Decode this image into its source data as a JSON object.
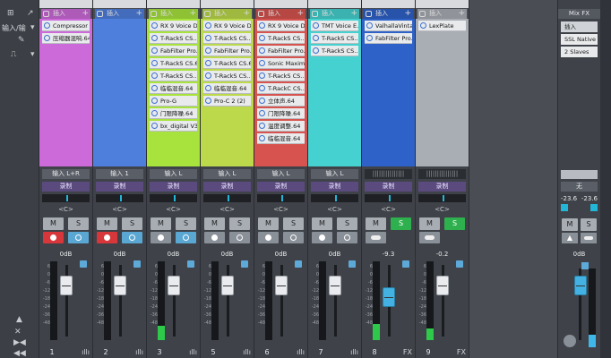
{
  "left_panel": {
    "input_label": "输入/输",
    "rows": [
      "▸",
      "⇄",
      "↺",
      "▸"
    ]
  },
  "channels": [
    {
      "id": "1",
      "head": "插入",
      "color": "#cc6ad9",
      "slots": [
        "Compressor",
        "压缩器混响.64"
      ],
      "io": "输入 L+R",
      "rec": "录制",
      "pan": "<C>",
      "solo_on": false,
      "btn_a": "red",
      "btn_b": "blue",
      "vol": "0dB",
      "meter": 0,
      "cap_blue": false
    },
    {
      "id": "2",
      "head": "插入",
      "color": "#4f7fdd",
      "slots": [],
      "io": "输入 1",
      "rec": "录制",
      "pan": "<C>",
      "solo_on": false,
      "btn_a": "red",
      "btn_b": "blue",
      "vol": "0dB",
      "meter": 0,
      "cap_blue": false
    },
    {
      "id": "3",
      "head": "插入",
      "color": "#a8e33d",
      "slots": [
        "RX 9 Voice D...",
        "T-RackS CS...",
        "FabFilter Pro...",
        "T-RackS CS.64",
        "T-RackS CS...",
        "临临混音.64",
        "Pro-G",
        "门限降噪.64",
        "bx_digital V3..."
      ],
      "io": "输入 L",
      "rec": "录制",
      "pan": "<C>",
      "solo_on": false,
      "btn_a": "gray",
      "btn_b": "blue",
      "vol": "0dB",
      "meter": 0.18,
      "cap_blue": false
    },
    {
      "id": "4",
      "head": "插入",
      "color": "#bbd94a",
      "slots": [
        "RX 9 Voice D...",
        "T-RackS CS...",
        "FabFilter Pro...",
        "T-RackS CS.64",
        "T-RackS CS...",
        "临临混音.64",
        "Pro-C 2 (2)"
      ],
      "io": "输入 L",
      "rec": "录制",
      "pan": "<C>",
      "solo_on": false,
      "btn_a": "gray",
      "btn_b": "gray",
      "vol": "0dB",
      "meter": 0,
      "cap_blue": false
    },
    {
      "id": "5",
      "head": "插入",
      "color": "#d6534f",
      "slots": [
        "RX 9 Voice D...",
        "T-RackS CS...",
        "FabFilter Pro...",
        "Sonic Maxim...",
        "T-RackS CS...",
        "T-RackC CS...",
        "立体声.64",
        "门限降噪.64",
        "温度调整.64",
        "临临混音.64"
      ],
      "io": "输入 L",
      "rec": "录制",
      "pan": "<C>",
      "solo_on": false,
      "btn_a": "gray",
      "btn_b": "gray",
      "vol": "0dB",
      "meter": 0,
      "cap_blue": false
    },
    {
      "id": "6",
      "head": "插入",
      "color": "#45d1cf",
      "slots": [
        "TMT Voice E...",
        "T-RackS CS...",
        "T-RackS CS..."
      ],
      "io": "输入 L",
      "rec": "录制",
      "pan": "<C>",
      "solo_on": false,
      "btn_a": "gray",
      "btn_b": "gray",
      "vol": "0dB",
      "meter": 0,
      "cap_blue": false
    },
    {
      "id": "7",
      "head": "插入",
      "color": "#2f62c8",
      "slots": [
        "ValhallaVinta...",
        "FabFilter Pro..."
      ],
      "io": "|||||||||||||||",
      "rec": "录制",
      "pan": "<C>",
      "solo_on": true,
      "btn_a": "gray",
      "btn_b": "none",
      "vol": "-9.3",
      "meter": 0.2,
      "cap_blue": true
    },
    {
      "id": "8",
      "head": "插入",
      "color": "#a9adb4",
      "slots": [
        "LexPlate"
      ],
      "io": "|||||||||||||||",
      "rec": "录制",
      "pan": "<C>",
      "solo_on": true,
      "btn_a": "gray",
      "btn_b": "none",
      "vol": "-0.2",
      "meter": 0.15,
      "cap_blue": false
    }
  ],
  "channel_numbers": [
    "1",
    "2",
    "3",
    "5",
    "6",
    "7",
    "8",
    "9"
  ],
  "fx_label": "FX",
  "mix_fx": {
    "title": "Mix FX",
    "slots": [
      "插入",
      "SSL Native B...",
      "2 Slaves"
    ],
    "preset": "无",
    "left_val": "-23.6",
    "right_val": "-23.6",
    "ms_m": "M",
    "ms_s": "S",
    "vol": "0dB"
  },
  "ms_labels": {
    "m": "M",
    "s": "S"
  },
  "scale_labels": [
    "6",
    "0",
    "-6",
    "-12",
    "-18",
    "-24",
    "-36",
    "-48"
  ]
}
